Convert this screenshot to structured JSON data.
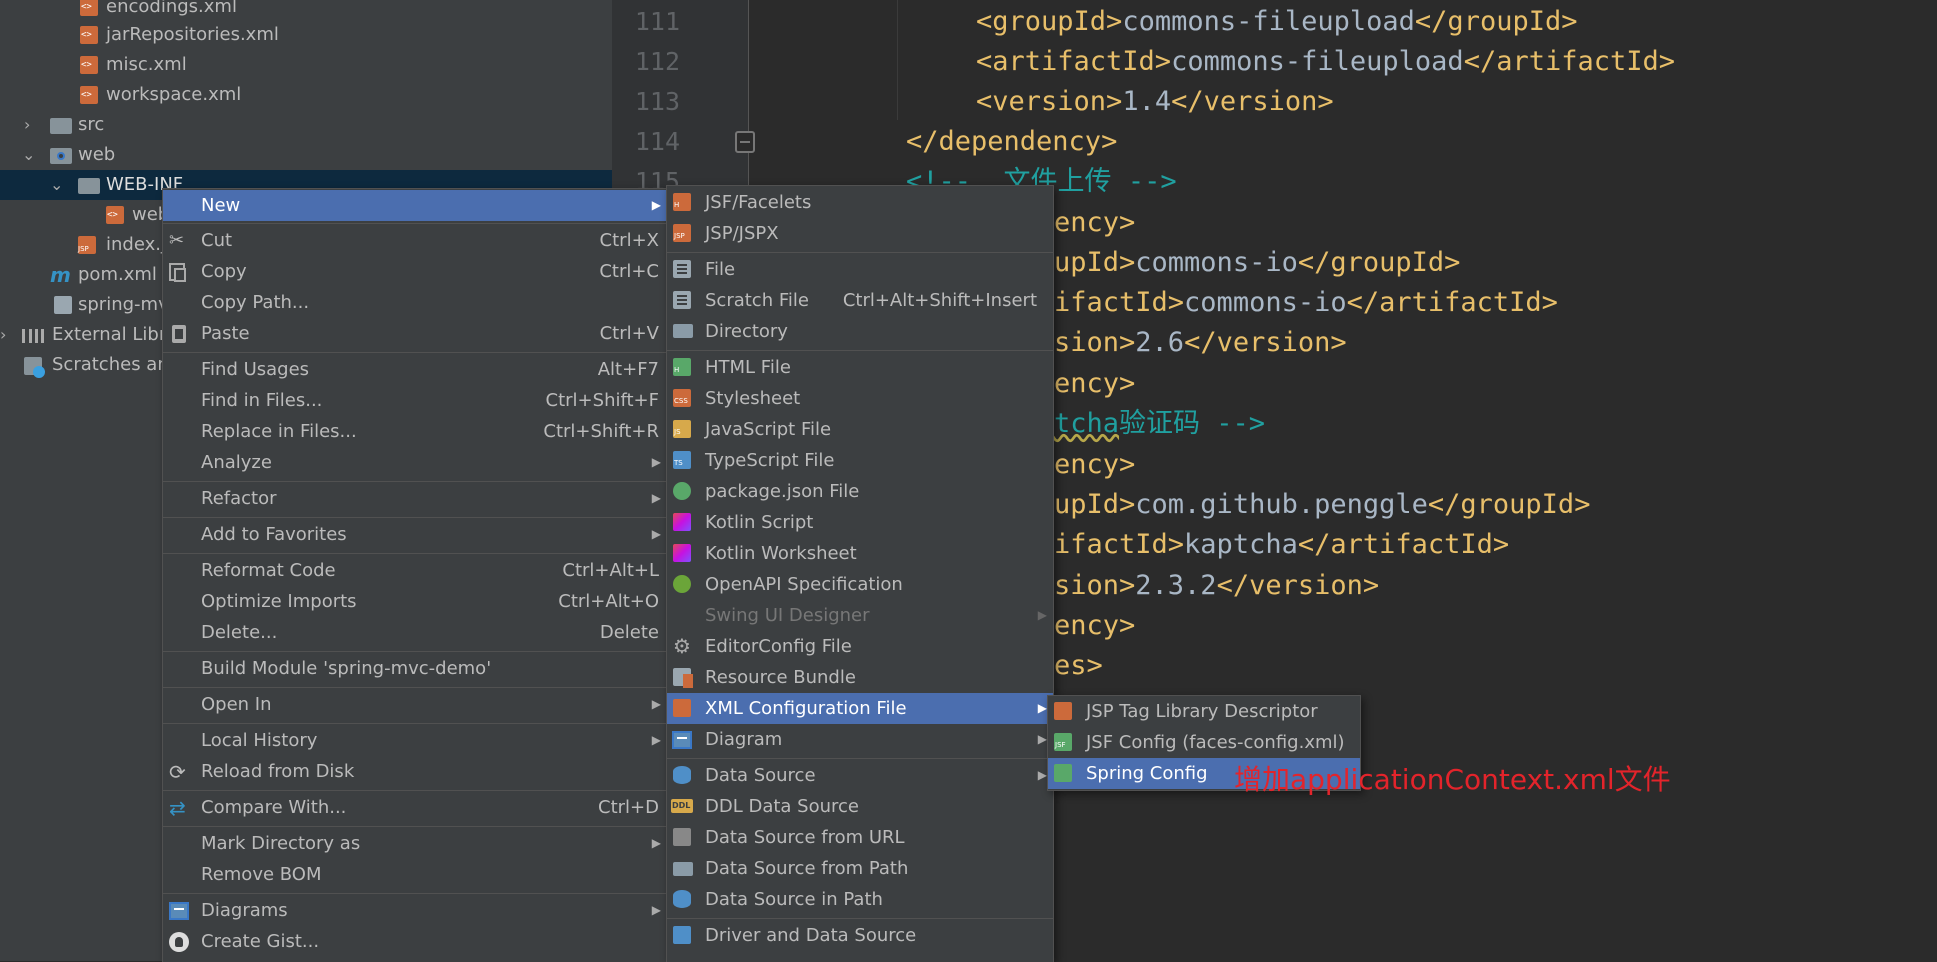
{
  "tree": {
    "items": [
      {
        "label": "encodings.xml"
      },
      {
        "label": "jarRepositories.xml"
      },
      {
        "label": "misc.xml"
      },
      {
        "label": "workspace.xml"
      },
      {
        "label": "src"
      },
      {
        "label": "web"
      },
      {
        "label": "WEB-INF"
      },
      {
        "label": "web"
      },
      {
        "label": "index.j"
      },
      {
        "label": "pom.xml"
      },
      {
        "label": "spring-mv"
      },
      {
        "label": "External Libra"
      },
      {
        "label": "Scratches and"
      }
    ]
  },
  "editor": {
    "line_numbers": [
      "111",
      "112",
      "113",
      "114",
      "115"
    ],
    "code": [
      {
        "tag1": "<groupId>",
        "text": "commons-fileupload",
        "tag2": "</groupId>"
      },
      {
        "tag1": "<artifactId>",
        "text": "commons-fileupload",
        "tag2": "</artifactId>"
      },
      {
        "tag1": "<version>",
        "text": "1.4",
        "tag2": "</version>"
      },
      {
        "tag1": "</dependency>",
        "text": "",
        "tag2": ""
      },
      {
        "tag1": "<!--",
        "text": "  文件上传 ",
        "tag2": "-->"
      },
      {
        "tag1": "ency>",
        "text": "",
        "tag2": ""
      },
      {
        "tag1": "upId>",
        "text": "commons-io",
        "tag2": "</groupId>"
      },
      {
        "tag1": "ifactId>",
        "text": "commons-io",
        "tag2": "</artifactId>"
      },
      {
        "tag1": "sion>",
        "text": "2.6",
        "tag2": "</version>"
      },
      {
        "tag1": "ency>",
        "text": "",
        "tag2": ""
      },
      {
        "tag1": "tcha",
        "text": "验证码 ",
        "tag2": "-->"
      },
      {
        "tag1": "ency>",
        "text": "",
        "tag2": ""
      },
      {
        "tag1": "upId>",
        "text": "com.github.penggle",
        "tag2": "</groupId>"
      },
      {
        "tag1": "ifactId>",
        "text": "kaptcha",
        "tag2": "</artifactId>"
      },
      {
        "tag1": "sion>",
        "text": "2.3.2",
        "tag2": "</version>"
      },
      {
        "tag1": "ency>",
        "text": "",
        "tag2": ""
      },
      {
        "tag1": "es>",
        "text": "",
        "tag2": ""
      }
    ]
  },
  "menu1": {
    "items": [
      {
        "label": "New",
        "shortcut": ""
      },
      {
        "label": "Cut",
        "shortcut": "Ctrl+X"
      },
      {
        "label": "Copy",
        "shortcut": "Ctrl+C"
      },
      {
        "label": "Copy Path...",
        "shortcut": ""
      },
      {
        "label": "Paste",
        "shortcut": "Ctrl+V"
      },
      {
        "label": "Find Usages",
        "shortcut": "Alt+F7"
      },
      {
        "label": "Find in Files...",
        "shortcut": "Ctrl+Shift+F"
      },
      {
        "label": "Replace in Files...",
        "shortcut": "Ctrl+Shift+R"
      },
      {
        "label": "Analyze",
        "shortcut": ""
      },
      {
        "label": "Refactor",
        "shortcut": ""
      },
      {
        "label": "Add to Favorites",
        "shortcut": ""
      },
      {
        "label": "Reformat Code",
        "shortcut": "Ctrl+Alt+L"
      },
      {
        "label": "Optimize Imports",
        "shortcut": "Ctrl+Alt+O"
      },
      {
        "label": "Delete...",
        "shortcut": "Delete"
      },
      {
        "label": "Build Module 'spring-mvc-demo'",
        "shortcut": ""
      },
      {
        "label": "Open In",
        "shortcut": ""
      },
      {
        "label": "Local History",
        "shortcut": ""
      },
      {
        "label": "Reload from Disk",
        "shortcut": ""
      },
      {
        "label": "Compare With...",
        "shortcut": "Ctrl+D"
      },
      {
        "label": "Mark Directory as",
        "shortcut": ""
      },
      {
        "label": "Remove BOM",
        "shortcut": ""
      },
      {
        "label": "Diagrams",
        "shortcut": ""
      },
      {
        "label": "Create Gist...",
        "shortcut": ""
      }
    ]
  },
  "menu2": {
    "items": [
      {
        "label": "JSF/Facelets",
        "shortcut": "",
        "icon_text": "H"
      },
      {
        "label": "JSP/JSPX",
        "shortcut": "",
        "icon_text": "JSP"
      },
      {
        "label": "File",
        "shortcut": ""
      },
      {
        "label": "Scratch File",
        "shortcut": "Ctrl+Alt+Shift+Insert"
      },
      {
        "label": "Directory",
        "shortcut": ""
      },
      {
        "label": "HTML File",
        "shortcut": "",
        "icon_text": "H"
      },
      {
        "label": "Stylesheet",
        "shortcut": "",
        "icon_text": "CSS"
      },
      {
        "label": "JavaScript File",
        "shortcut": "",
        "icon_text": "JS"
      },
      {
        "label": "TypeScript File",
        "shortcut": "",
        "icon_text": "TS"
      },
      {
        "label": "package.json File",
        "shortcut": ""
      },
      {
        "label": "Kotlin Script",
        "shortcut": ""
      },
      {
        "label": "Kotlin Worksheet",
        "shortcut": ""
      },
      {
        "label": "OpenAPI Specification",
        "shortcut": ""
      },
      {
        "label": "Swing UI Designer",
        "shortcut": ""
      },
      {
        "label": "EditorConfig File",
        "shortcut": ""
      },
      {
        "label": "Resource Bundle",
        "shortcut": ""
      },
      {
        "label": "XML Configuration File",
        "shortcut": ""
      },
      {
        "label": "Diagram",
        "shortcut": ""
      },
      {
        "label": "Data Source",
        "shortcut": ""
      },
      {
        "label": "DDL Data Source",
        "shortcut": ""
      },
      {
        "label": "Data Source from URL",
        "shortcut": ""
      },
      {
        "label": "Data Source from Path",
        "shortcut": ""
      },
      {
        "label": "Data Source in Path",
        "shortcut": ""
      },
      {
        "label": "Driver and Data Source",
        "shortcut": ""
      }
    ]
  },
  "menu3": {
    "items": [
      {
        "label": "JSP Tag Library Descriptor",
        "icon_text": ""
      },
      {
        "label": "JSF Config (faces-config.xml)",
        "icon_text": "JSF"
      },
      {
        "label": "Spring Config",
        "icon_text": ""
      }
    ]
  },
  "annotation": {
    "text": "增加applicationContext.xml文件"
  },
  "colors": {
    "selection": "#4b6eaf",
    "annotation": "#e3242b",
    "tag": "#e8bf6a"
  }
}
